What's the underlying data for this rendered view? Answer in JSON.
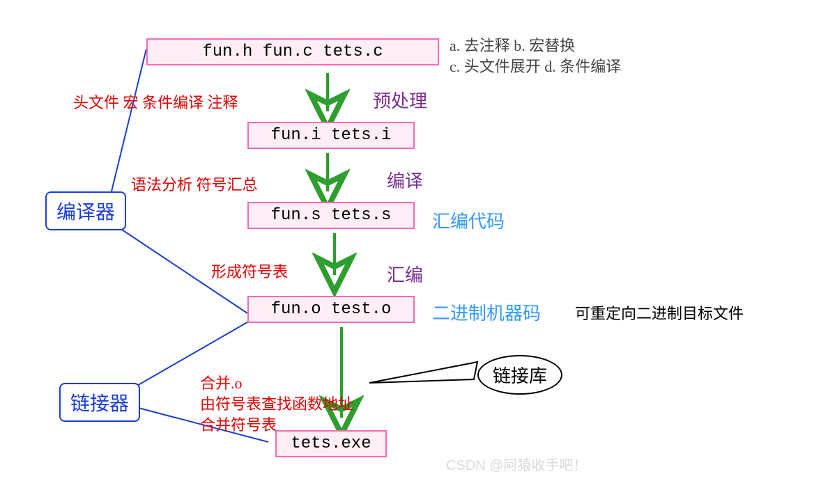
{
  "boxes": {
    "source": "fun.h  fun.c  tets.c",
    "preprocessed": "fun.i  tets.i",
    "compiled": "fun.s  tets.s",
    "assembled": "fun.o  test.o",
    "linked": "tets.exe"
  },
  "nodes": {
    "compiler": "编译器",
    "linker": "链接器",
    "library": "链接库"
  },
  "stages": {
    "preprocess": "预处理",
    "compile": "编译",
    "assemble": "汇编"
  },
  "annotations": {
    "preprocess_left": "头文件 宏 条件编译 注释",
    "compile_left": "语法分析 符号汇总",
    "assemble_left": "形成符号表",
    "link_left1": "合并.o",
    "link_left2": "由符号表查找函数地址",
    "link_left3": "合并符号表"
  },
  "side_text": {
    "asm_code": "汇编代码",
    "bin_code": "二进制机器码",
    "bin_desc": "可重定向二进制目标文件"
  },
  "top_note": {
    "line1": "a.  去注释 b.  宏替换",
    "line2": "c.  头文件展开 d.  条件编译"
  },
  "watermark": "CSDN @阿猿收手吧！"
}
